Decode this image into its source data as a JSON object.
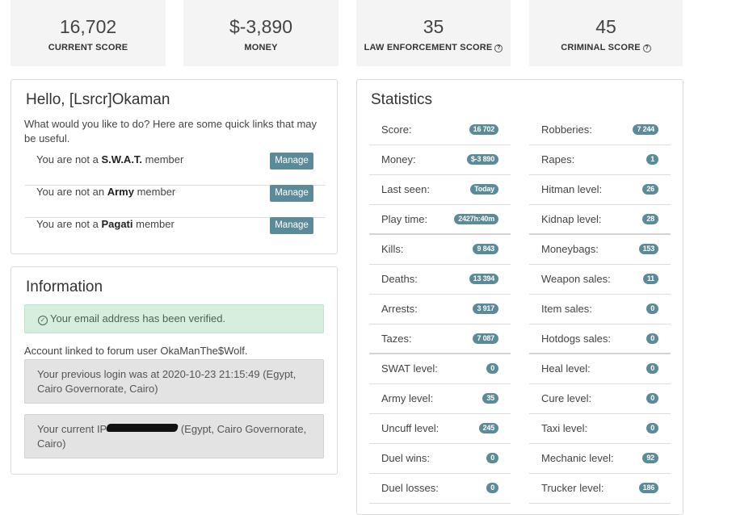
{
  "top_stats": [
    {
      "value": "16,702",
      "label": "CURRENT SCORE",
      "help": false
    },
    {
      "value": "$-3,890",
      "label": "MONEY",
      "help": false
    },
    {
      "value": "35",
      "label": "LAW ENFORCEMENT SCORE",
      "help": true
    },
    {
      "value": "45",
      "label": "CRIMINAL SCORE",
      "help": true
    }
  ],
  "welcome": {
    "title": "Hello, [Lsrcr]Okaman",
    "prompt": "What would you like to do? Here are some quick links that may be useful.",
    "memberships": [
      {
        "prefix": "You are not a ",
        "group": "S.W.A.T.",
        "suffix": " member",
        "button": "Manage"
      },
      {
        "prefix": "You are not an ",
        "group": "Army",
        "suffix": " member",
        "button": "Manage"
      },
      {
        "prefix": "You are not a ",
        "group": "Pagati",
        "suffix": " member",
        "button": "Manage"
      }
    ]
  },
  "information": {
    "title": "Information",
    "verified_message": "Your email address has been verified.",
    "forum_link": "Account linked to forum user OkaManThe$Wolf.",
    "previous_login": "Your previous login was at 2020-10-23 21:15:49 (Egypt, Cairo Governorate, Cairo)",
    "current_ip_prefix": "Your current IP",
    "current_ip_suffix": " (Egypt, Cairo Governorate, Cairo)"
  },
  "statistics": {
    "title": "Statistics",
    "left": [
      {
        "label": "Score:",
        "value": "16 702"
      },
      {
        "label": "Money:",
        "value": "$-3 890"
      },
      {
        "label": "Last seen:",
        "value": "Today"
      },
      {
        "label": "Play time:",
        "value": "2427h:40m"
      },
      {
        "label": "Kills:",
        "value": "9 843"
      },
      {
        "label": "Deaths:",
        "value": "13 394"
      },
      {
        "label": "Arrests:",
        "value": "3 917"
      },
      {
        "label": "Tazes:",
        "value": "7 087"
      },
      {
        "label": "SWAT level:",
        "value": "0"
      },
      {
        "label": "Army level:",
        "value": "35"
      },
      {
        "label": "Uncuff level:",
        "value": "245"
      },
      {
        "label": "Duel wins:",
        "value": "0"
      },
      {
        "label": "Duel losses:",
        "value": "0"
      }
    ],
    "right": [
      {
        "label": "Robberies:",
        "value": "7 244"
      },
      {
        "label": "Rapes:",
        "value": "1"
      },
      {
        "label": "Hitman level:",
        "value": "26"
      },
      {
        "label": "Kidnap level:",
        "value": "28"
      },
      {
        "label": "Moneybags:",
        "value": "153"
      },
      {
        "label": "Weapon sales:",
        "value": "11"
      },
      {
        "label": "Item sales:",
        "value": "0"
      },
      {
        "label": "Hotdogs sales:",
        "value": "0"
      },
      {
        "label": "Heal level:",
        "value": "0"
      },
      {
        "label": "Cure level:",
        "value": "0"
      },
      {
        "label": "Taxi level:",
        "value": "0"
      },
      {
        "label": "Mechanic level:",
        "value": "92"
      },
      {
        "label": "Trucker level:",
        "value": "186"
      }
    ]
  }
}
